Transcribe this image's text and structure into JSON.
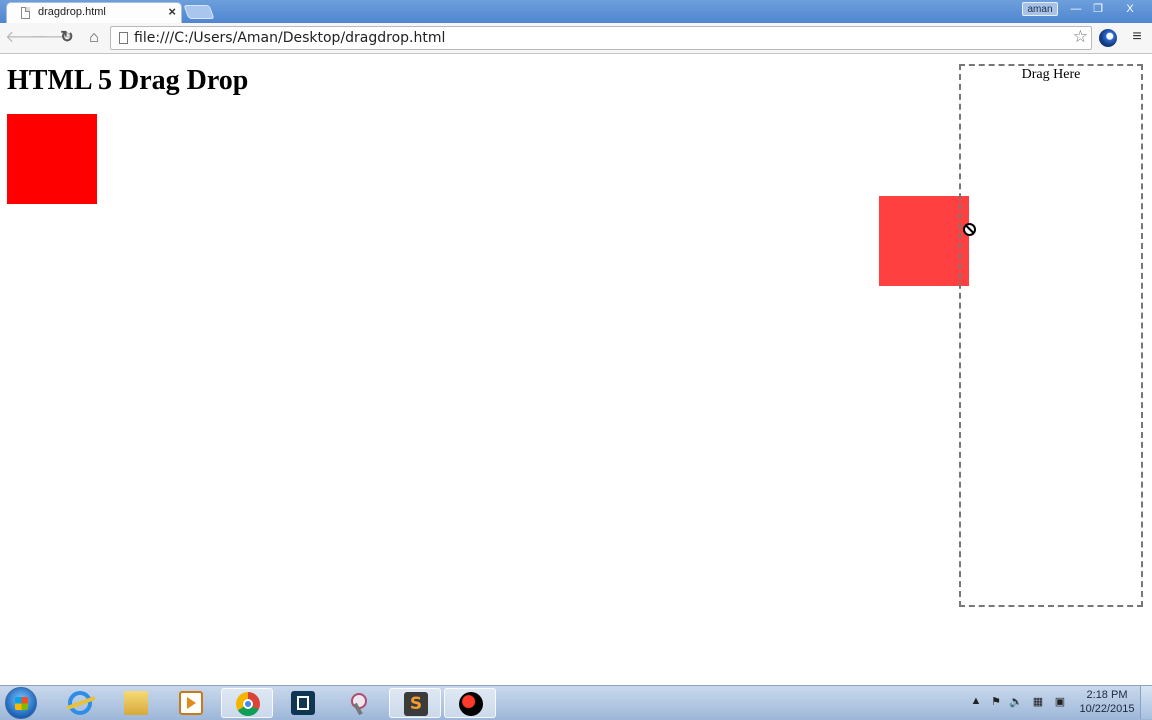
{
  "browser": {
    "tab_title": "dragdrop.html",
    "tab_close": "×",
    "user_name": "aman",
    "window_controls": {
      "minimize": "—",
      "maximize": "❐",
      "close": "X"
    },
    "url": "file:///C:/Users/Aman/Desktop/dragdrop.html",
    "nav_icons": {
      "back": "🡐",
      "forward": "🡒",
      "reload": "↻",
      "home": "⌂"
    },
    "star": "☆",
    "menu": "≡"
  },
  "page": {
    "heading": "HTML 5 Drag Drop",
    "drop_zone_label": "Drag Here",
    "colors": {
      "box": "#ff0000",
      "drop_zone_border": "#777777"
    },
    "cursor": "no-drop-icon"
  },
  "taskbar": {
    "apps": [
      "start-orb",
      "internet-explorer-icon",
      "windows-explorer-icon",
      "media-player-icon",
      "chrome-icon",
      "brackets-icon",
      "snipping-tool-icon",
      "sublime-text-icon",
      "screen-recorder-icon"
    ],
    "sublime_letter": "S",
    "tray": {
      "show_hidden": "▲"
    },
    "clock_time": "2:18 PM",
    "clock_date": "10/22/2015"
  }
}
